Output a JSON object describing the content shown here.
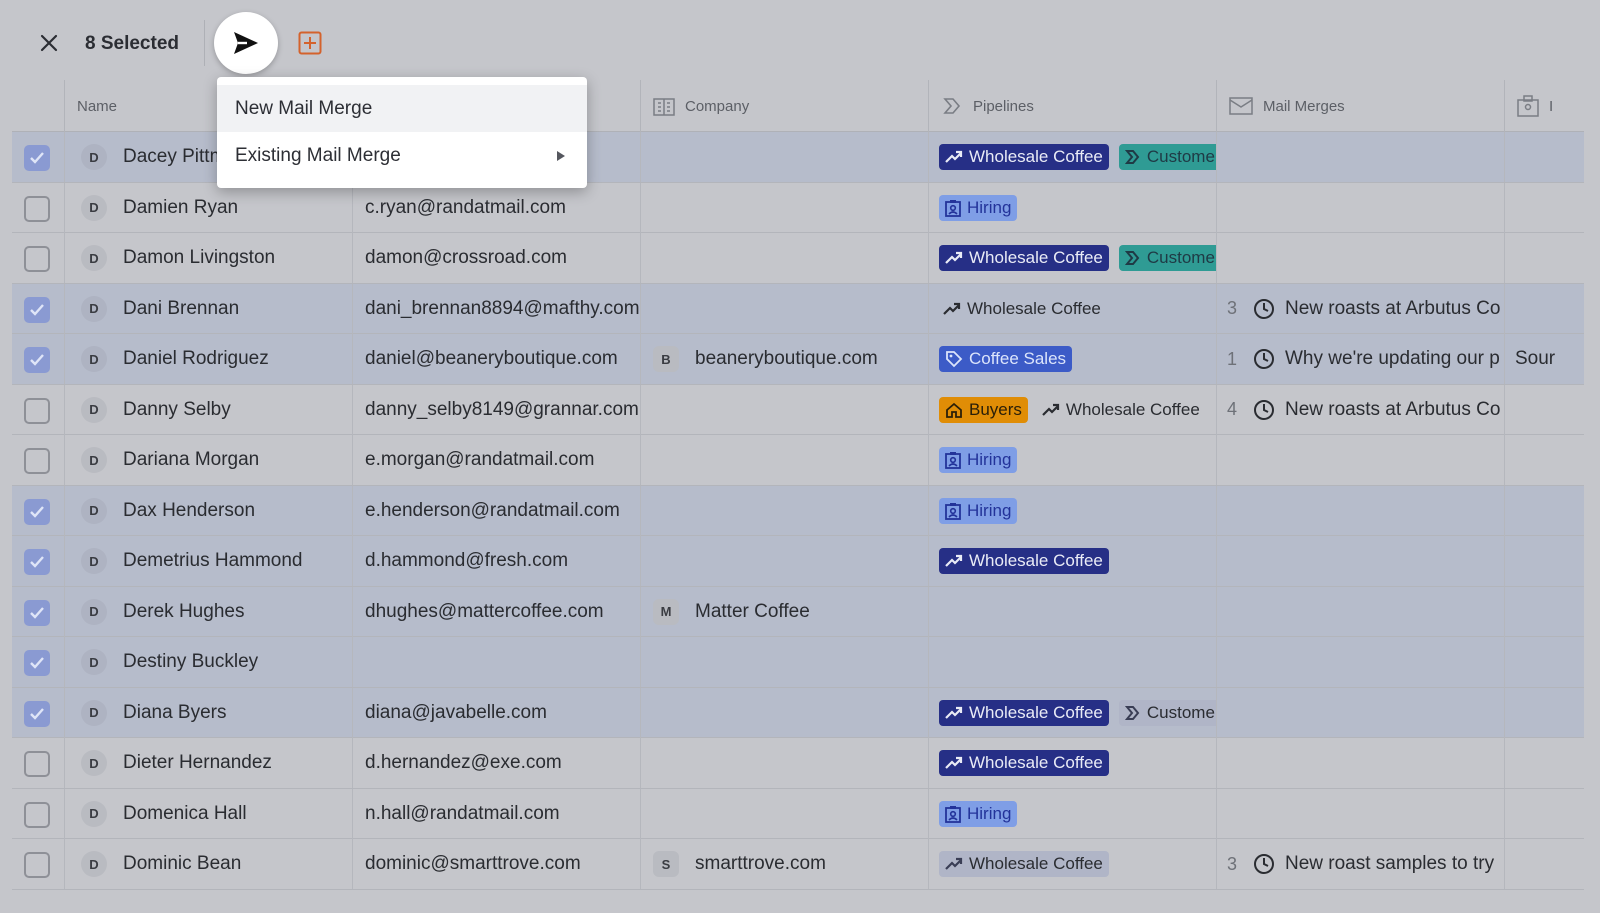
{
  "toolbar": {
    "selected_label": "8 Selected"
  },
  "menu": {
    "items": [
      {
        "label": "New Mail Merge"
      },
      {
        "label": "Existing Mail Merge"
      }
    ]
  },
  "columns": {
    "name": "Name",
    "company": "Company",
    "pipelines": "Pipelines",
    "mail_merges": "Mail Merges",
    "extra": "I"
  },
  "colors": {
    "checkbox_checked": "#8a9ad2",
    "wholesale_coffee": "#262f86",
    "customer": "#2f9b94",
    "hiring": "#7f9ee6",
    "coffee_sales": "#3c5bc7",
    "buyers": "#e08d06"
  },
  "rows": [
    {
      "checked": true,
      "initial": "D",
      "name": "Dacey Pittman",
      "email": "",
      "company_initial": "",
      "company": "",
      "tags": [
        {
          "label": "Wholesale Coffee",
          "kind": "wc",
          "icon": "trend-icon"
        },
        {
          "label": "Custome",
          "kind": "cu",
          "icon": "pipeline-icon"
        }
      ],
      "mm_count": "",
      "mm_text": "",
      "extra": ""
    },
    {
      "checked": false,
      "initial": "D",
      "name": "Damien Ryan",
      "email": "c.ryan@randatmail.com",
      "company_initial": "",
      "company": "",
      "tags": [
        {
          "label": "Hiring",
          "kind": "hi",
          "icon": "badge-icon"
        }
      ],
      "mm_count": "",
      "mm_text": "",
      "extra": ""
    },
    {
      "checked": false,
      "initial": "D",
      "name": "Damon Livingston",
      "email": "damon@crossroad.com",
      "company_initial": "",
      "company": "",
      "tags": [
        {
          "label": "Wholesale Coffee",
          "kind": "wc",
          "icon": "trend-icon"
        },
        {
          "label": "Custome",
          "kind": "cu",
          "icon": "pipeline-icon"
        }
      ],
      "mm_count": "",
      "mm_text": "",
      "extra": ""
    },
    {
      "checked": true,
      "initial": "D",
      "name": "Dani Brennan",
      "email": "dani_brennan8894@mafthy.com",
      "company_initial": "",
      "company": "",
      "tags": [
        {
          "label": "Wholesale Coffee",
          "kind": "plain",
          "icon": "trend-icon"
        }
      ],
      "mm_count": "3",
      "mm_text": "New roasts at Arbutus Co",
      "extra": ""
    },
    {
      "checked": true,
      "initial": "D",
      "name": "Daniel Rodriguez",
      "email": "daniel@beaneryboutique.com",
      "company_initial": "B",
      "company": "beaneryboutique.com",
      "tags": [
        {
          "label": "Coffee Sales",
          "kind": "cs",
          "icon": "tag-icon"
        }
      ],
      "mm_count": "1",
      "mm_text": "Why we're updating our p",
      "extra": "Sour"
    },
    {
      "checked": false,
      "initial": "D",
      "name": "Danny Selby",
      "email": "danny_selby8149@grannar.com",
      "company_initial": "",
      "company": "",
      "tags": [
        {
          "label": "Buyers",
          "kind": "bu",
          "icon": "home-icon"
        },
        {
          "label": "Wholesale Coffee",
          "kind": "plain",
          "icon": "trend-icon"
        }
      ],
      "mm_count": "4",
      "mm_text": "New roasts at Arbutus Co",
      "extra": ""
    },
    {
      "checked": false,
      "initial": "D",
      "name": "Dariana Morgan",
      "email": "e.morgan@randatmail.com",
      "company_initial": "",
      "company": "",
      "tags": [
        {
          "label": "Hiring",
          "kind": "hi",
          "icon": "badge-icon"
        }
      ],
      "mm_count": "",
      "mm_text": "",
      "extra": ""
    },
    {
      "checked": true,
      "initial": "D",
      "name": "Dax Henderson",
      "email": "e.henderson@randatmail.com",
      "company_initial": "",
      "company": "",
      "tags": [
        {
          "label": "Hiring",
          "kind": "hi",
          "icon": "badge-icon"
        }
      ],
      "mm_count": "",
      "mm_text": "",
      "extra": ""
    },
    {
      "checked": true,
      "initial": "D",
      "name": "Demetrius Hammond",
      "email": "d.hammond@fresh.com",
      "company_initial": "",
      "company": "",
      "tags": [
        {
          "label": "Wholesale Coffee",
          "kind": "wc",
          "icon": "trend-icon"
        }
      ],
      "mm_count": "",
      "mm_text": "",
      "extra": ""
    },
    {
      "checked": true,
      "initial": "D",
      "name": "Derek Hughes",
      "email": "dhughes@mattercoffee.com",
      "company_initial": "M",
      "company": "Matter Coffee",
      "tags": [],
      "mm_count": "",
      "mm_text": "",
      "extra": ""
    },
    {
      "checked": true,
      "initial": "D",
      "name": "Destiny Buckley",
      "email": "",
      "company_initial": "",
      "company": "",
      "tags": [],
      "mm_count": "",
      "mm_text": "",
      "extra": ""
    },
    {
      "checked": true,
      "initial": "D",
      "name": "Diana Byers",
      "email": "diana@javabelle.com",
      "company_initial": "",
      "company": "",
      "tags": [
        {
          "label": "Wholesale Coffee",
          "kind": "wc",
          "icon": "trend-icon"
        },
        {
          "label": "Custome",
          "kind": "light",
          "icon": "pipeline-icon"
        }
      ],
      "mm_count": "",
      "mm_text": "",
      "extra": ""
    },
    {
      "checked": false,
      "initial": "D",
      "name": "Dieter Hernandez",
      "email": "d.hernandez@exe.com",
      "company_initial": "",
      "company": "",
      "tags": [
        {
          "label": "Wholesale Coffee",
          "kind": "wc",
          "icon": "trend-icon"
        }
      ],
      "mm_count": "",
      "mm_text": "",
      "extra": ""
    },
    {
      "checked": false,
      "initial": "D",
      "name": "Domenica Hall",
      "email": "n.hall@randatmail.com",
      "company_initial": "",
      "company": "",
      "tags": [
        {
          "label": "Hiring",
          "kind": "hi",
          "icon": "badge-icon"
        }
      ],
      "mm_count": "",
      "mm_text": "",
      "extra": ""
    },
    {
      "checked": false,
      "initial": "D",
      "name": "Dominic Bean",
      "email": "dominic@smarttrove.com",
      "company_initial": "S",
      "company": "smarttrove.com",
      "tags": [
        {
          "label": "Wholesale Coffee",
          "kind": "light",
          "icon": "trend-icon"
        }
      ],
      "mm_count": "3",
      "mm_text": "New roast samples to try",
      "extra": ""
    }
  ]
}
